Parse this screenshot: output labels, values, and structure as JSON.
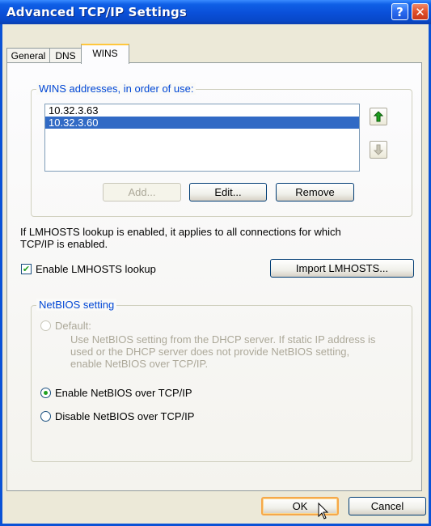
{
  "window": {
    "title": "Advanced TCP/IP Settings",
    "help_icon": "help-icon",
    "close_icon": "close-icon"
  },
  "tabs": [
    {
      "label": "General",
      "active": false
    },
    {
      "label": "DNS",
      "active": false
    },
    {
      "label": "WINS",
      "active": true
    }
  ],
  "wins": {
    "group_title": "WINS addresses, in order of use:",
    "addresses": [
      "10.32.3.63",
      "10.32.3.60"
    ],
    "selected_index": 1,
    "add_label": "Add...",
    "edit_label": "Edit...",
    "remove_label": "Remove",
    "move_up_icon": "arrow-up-icon",
    "move_down_icon": "arrow-down-icon"
  },
  "lmhosts": {
    "info_text_line1": "If LMHOSTS lookup is enabled, it applies to all connections for which",
    "info_text_line2": "TCP/IP is enabled.",
    "enable_label": "Enable LMHOSTS lookup",
    "enable_checked": true,
    "import_label": "Import LMHOSTS..."
  },
  "netbios": {
    "group_title": "NetBIOS setting",
    "default_label": "Default:",
    "default_desc_line1": "Use NetBIOS setting from the DHCP server. If static IP address is",
    "default_desc_line2": "used or the DHCP server does not provide NetBIOS setting,",
    "default_desc_line3": "enable NetBIOS over TCP/IP.",
    "enable_label": "Enable NetBIOS over TCP/IP",
    "disable_label": "Disable NetBIOS over TCP/IP",
    "selected": "enable"
  },
  "footer": {
    "ok_label": "OK",
    "cancel_label": "Cancel"
  },
  "colors": {
    "titlebar": "#0a4fd8",
    "group_title": "#0046d5",
    "selection": "#316ac5",
    "check": "#21a121",
    "default_button_border": "#f6a84a"
  }
}
